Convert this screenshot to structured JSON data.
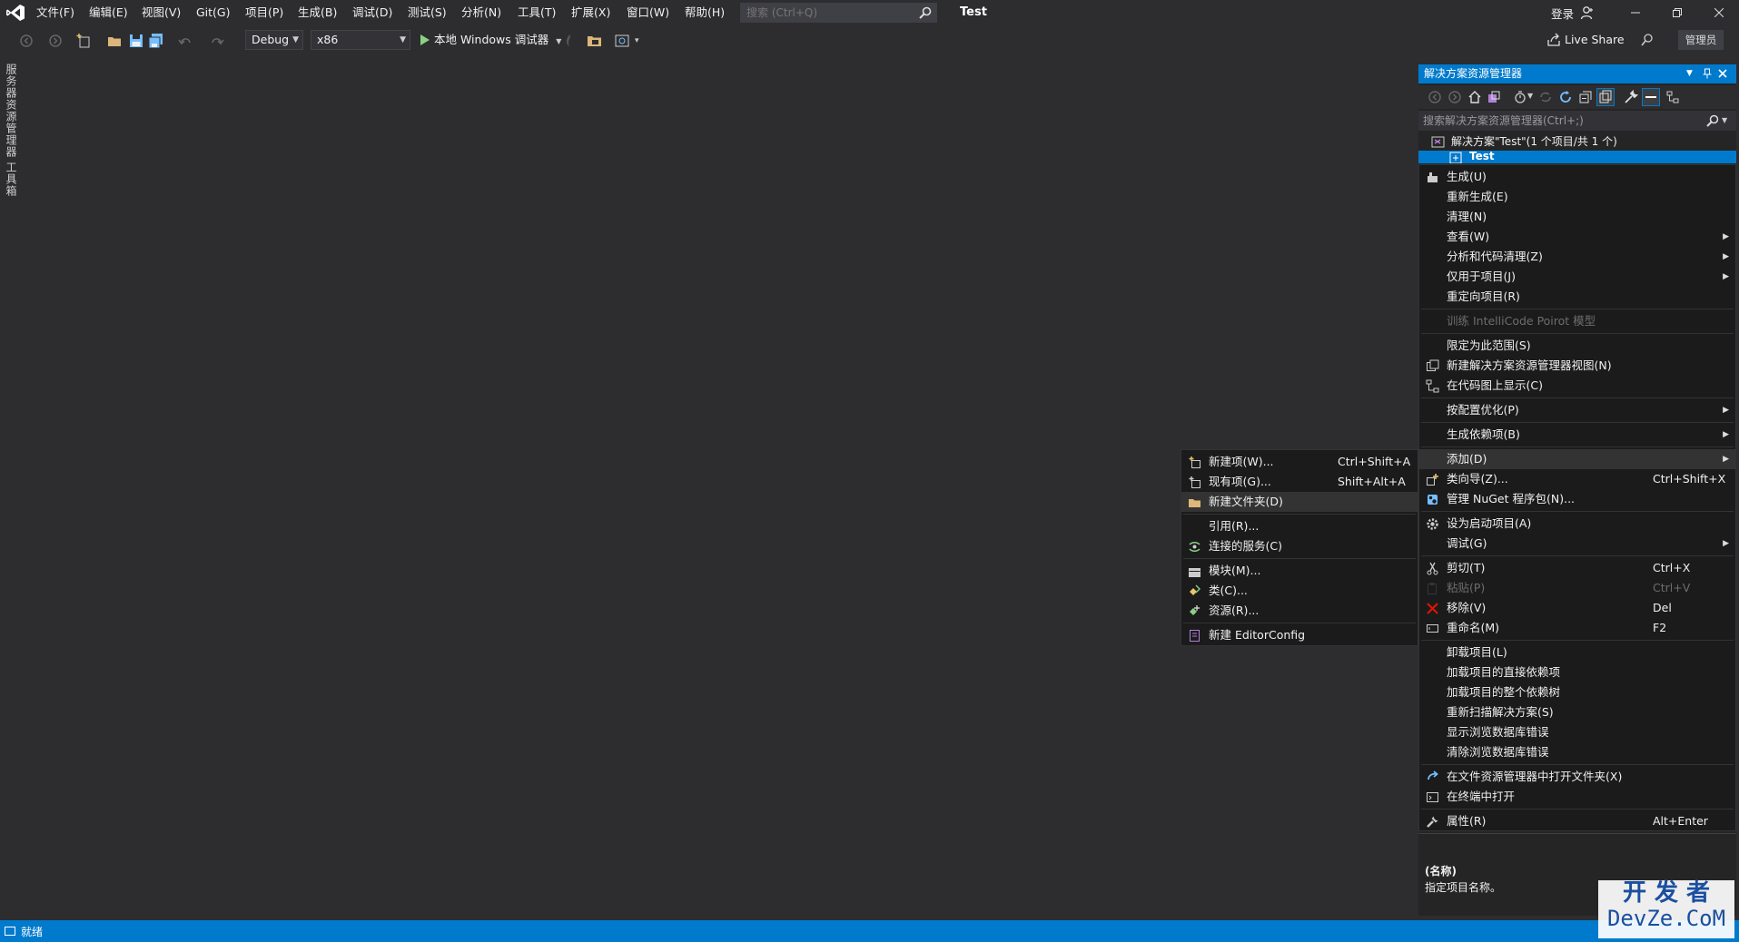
{
  "menu": [
    "文件(F)",
    "编辑(E)",
    "视图(V)",
    "Git(G)",
    "项目(P)",
    "生成(B)",
    "调试(D)",
    "测试(S)",
    "分析(N)",
    "工具(T)",
    "扩展(X)",
    "窗口(W)",
    "帮助(H)"
  ],
  "search": {
    "placeholder": "搜索 (Ctrl+Q)"
  },
  "title": "Test",
  "account": {
    "login": "登录"
  },
  "toolbar": {
    "config": "Debug",
    "platform": "x86",
    "run_label": "本地 Windows 调试器",
    "live_share": "Live Share",
    "admin": "管理员"
  },
  "left_tabs": [
    "服务器资源管理器",
    "工具箱"
  ],
  "solution_explorer": {
    "title": "解决方案资源管理器",
    "search_placeholder": "搜索解决方案资源管理器(Ctrl+;)",
    "solution_node": "解决方案\"Test\"(1 个项目/共 1 个)",
    "project_node": "Test"
  },
  "context_menu": [
    {
      "label": "生成(U)",
      "icon": "build-icon"
    },
    {
      "label": "重新生成(E)"
    },
    {
      "label": "清理(N)"
    },
    {
      "label": "查看(W)",
      "submenu": true
    },
    {
      "label": "分析和代码清理(Z)",
      "submenu": true
    },
    {
      "label": "仅用于项目(J)",
      "submenu": true
    },
    {
      "label": "重定向项目(R)"
    },
    {
      "separator": true
    },
    {
      "label": "训练 IntelliCode Poirot 模型",
      "disabled": true
    },
    {
      "separator": true
    },
    {
      "label": "限定为此范围(S)"
    },
    {
      "label": "新建解决方案资源管理器视图(N)",
      "icon": "new-view-icon"
    },
    {
      "label": "在代码图上显示(C)",
      "icon": "code-map-icon"
    },
    {
      "separator": true
    },
    {
      "label": "按配置优化(P)",
      "submenu": true
    },
    {
      "separator": true
    },
    {
      "label": "生成依赖项(B)",
      "submenu": true
    },
    {
      "separator": true
    },
    {
      "label": "添加(D)",
      "submenu": true,
      "highlight": true
    },
    {
      "label": "类向导(Z)...",
      "shortcut": "Ctrl+Shift+X",
      "icon": "class-wizard-icon"
    },
    {
      "label": "管理 NuGet 程序包(N)...",
      "icon": "nuget-icon"
    },
    {
      "separator": true
    },
    {
      "label": "设为启动项目(A)",
      "icon": "gear-icon"
    },
    {
      "label": "调试(G)",
      "submenu": true
    },
    {
      "separator": true
    },
    {
      "label": "剪切(T)",
      "shortcut": "Ctrl+X",
      "icon": "scissors-icon"
    },
    {
      "label": "粘贴(P)",
      "shortcut": "Ctrl+V",
      "icon": "paste-icon",
      "disabled": true
    },
    {
      "label": "移除(V)",
      "shortcut": "Del",
      "icon": "remove-icon"
    },
    {
      "label": "重命名(M)",
      "shortcut": "F2",
      "icon": "rename-icon"
    },
    {
      "separator": true
    },
    {
      "label": "卸载项目(L)"
    },
    {
      "label": "加载项目的直接依赖项"
    },
    {
      "label": "加载项目的整个依赖树"
    },
    {
      "label": "重新扫描解决方案(S)"
    },
    {
      "label": "显示浏览数据库错误"
    },
    {
      "label": "清除浏览数据库错误"
    },
    {
      "separator": true
    },
    {
      "label": "在文件资源管理器中打开文件夹(X)",
      "icon": "open-folder-arrow-icon"
    },
    {
      "label": "在终端中打开",
      "icon": "terminal-icon"
    },
    {
      "separator": true
    },
    {
      "label": "属性(R)",
      "shortcut": "Alt+Enter",
      "icon": "wrench-icon"
    }
  ],
  "add_submenu": [
    {
      "label": "新建项(W)...",
      "shortcut": "Ctrl+Shift+A",
      "icon": "new-item-icon"
    },
    {
      "label": "现有项(G)...",
      "shortcut": "Shift+Alt+A",
      "icon": "existing-item-icon"
    },
    {
      "label": "新建文件夹(D)",
      "icon": "new-folder-icon",
      "highlight": true
    },
    {
      "separator": true
    },
    {
      "label": "引用(R)..."
    },
    {
      "label": "连接的服务(C)",
      "icon": "connected-service-icon"
    },
    {
      "separator": true
    },
    {
      "label": "模块(M)...",
      "icon": "module-icon"
    },
    {
      "label": "类(C)...",
      "icon": "class-icon"
    },
    {
      "label": "资源(R)...",
      "icon": "resource-icon"
    },
    {
      "separator": true
    },
    {
      "label": "新建 EditorConfig",
      "icon": "editorconfig-icon"
    }
  ],
  "properties": {
    "name_label": "(名称)",
    "description": "指定项目名称。"
  },
  "status": {
    "text": "就绪"
  },
  "watermark": {
    "line1": "开 发 者",
    "line2": "DevZe.CoM"
  },
  "colors": {
    "accent": "#007acc",
    "background": "#2d2d30",
    "menu_bg": "#1b1b1c",
    "panel_bg": "#252526"
  }
}
